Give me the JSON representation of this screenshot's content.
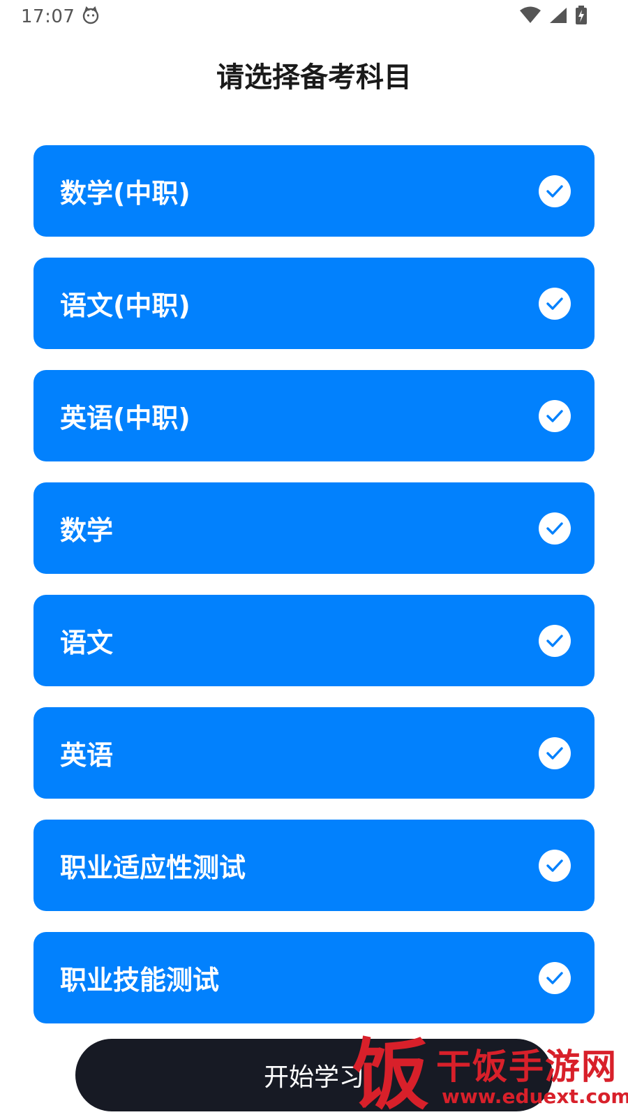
{
  "status_bar": {
    "time": "17:07",
    "icons": [
      "cat-icon",
      "wifi-icon",
      "signal-icon",
      "battery-charging-icon"
    ]
  },
  "page": {
    "title": "请选择备考科目"
  },
  "subjects": [
    {
      "label": "数学(中职)",
      "selected": true
    },
    {
      "label": "语文(中职)",
      "selected": true
    },
    {
      "label": "英语(中职)",
      "selected": true
    },
    {
      "label": "数学",
      "selected": true
    },
    {
      "label": "语文",
      "selected": true
    },
    {
      "label": "英语",
      "selected": true
    },
    {
      "label": "职业适应性测试",
      "selected": true
    },
    {
      "label": "职业技能测试",
      "selected": true
    }
  ],
  "start_button": {
    "label": "开始学习"
  },
  "watermark": {
    "logo_char": "饭",
    "site_name": "干饭手游网",
    "url": "www.eduext.com"
  },
  "colors": {
    "accent": "#0281fd",
    "button_dark": "#171a24",
    "watermark_red": "#d8202a"
  }
}
